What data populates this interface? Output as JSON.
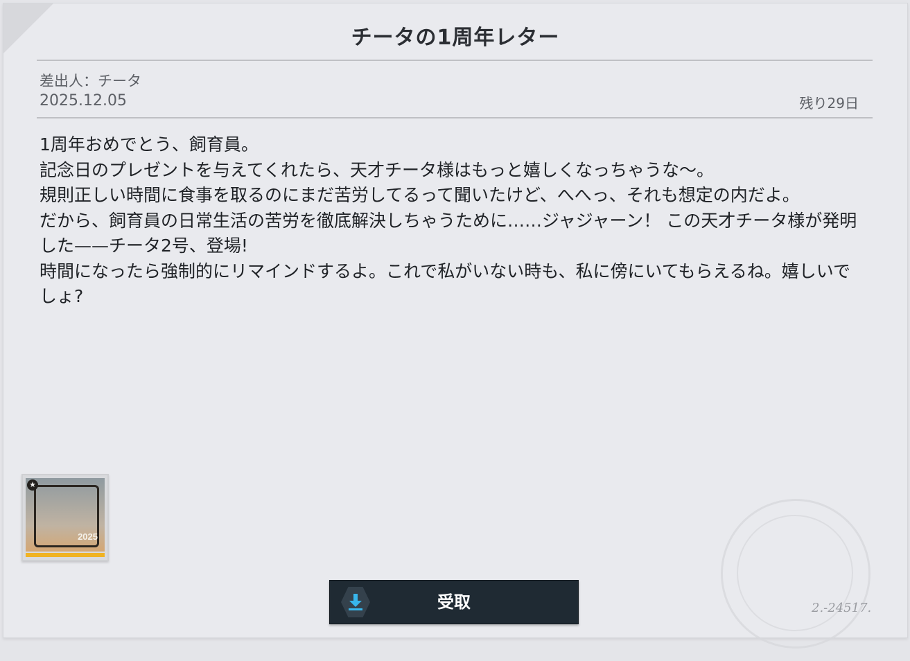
{
  "letter": {
    "title": "チータの1周年レター",
    "sender": "差出人：チータ",
    "date": "2025.12.05",
    "remaining": "残り29日",
    "body": [
      "1周年おめでとう、飼育員。",
      "記念日のプレゼントを与えてくれたら、天才チータ様はもっと嬉しくなっちゃうな〜。",
      "規則正しい時間に食事を取るのにまだ苦労してるって聞いたけど、へへっ、それも想定の内だよ。",
      "だから、飼育員の日常生活の苦労を徹底解決しちゃうために……ジャジャーン！ この天才チータ様が発明した——チータ2号、登場!",
      "時間になったら強制的にリマインドするよ。これで私がいない時も、私に傍にいてもらえるね。嬉しいでしょ?"
    ]
  },
  "reward": {
    "name": "anniversary-frame",
    "year_label": "2025",
    "bar_color": "#f0b323"
  },
  "claim_button": {
    "label": "受取",
    "icon": "download-icon",
    "accent": "#38b6ec"
  },
  "stamp": {
    "signature": "2.-24517."
  }
}
